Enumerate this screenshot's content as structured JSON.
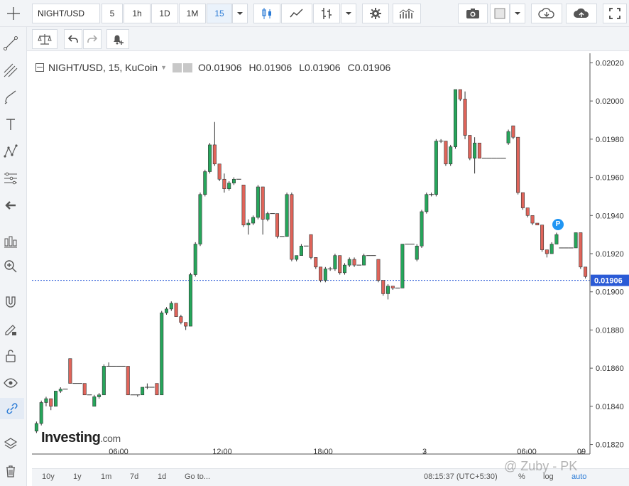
{
  "toolbar": {
    "symbol": "NIGHT/USD",
    "intervals": [
      "5",
      "1h",
      "1D",
      "1M",
      "15"
    ],
    "active_interval": "15"
  },
  "legend": {
    "title": "NIGHT/USD, 15, KuCoin",
    "ohlc": [
      "O0.01906",
      "H0.01906",
      "L0.01906",
      "C0.01906"
    ]
  },
  "price_axis": {
    "ticks": [
      "0.02020",
      "0.02000",
      "0.01980",
      "0.01960",
      "0.01940",
      "0.01920",
      "0.01900",
      "0.01880",
      "0.01860",
      "0.01840",
      "0.01820"
    ],
    "current_price": "0.01906"
  },
  "time_axis": {
    "ticks": [
      "06:00",
      "12:00",
      "18:00",
      "3",
      "06:00",
      "09"
    ]
  },
  "bottom": {
    "ranges": [
      "10y",
      "1y",
      "1m",
      "7d",
      "1d",
      "Go to..."
    ],
    "clock": "08:15:37 (UTC+5:30)",
    "scale_buttons": [
      "%",
      "log",
      "auto"
    ]
  },
  "branding": {
    "logo": "Investing",
    "logo_suffix": ".com",
    "watermark": "@ Zuby - PK",
    "marker": "P"
  },
  "chart_data": {
    "type": "candlestick",
    "up_color": "#26a65b",
    "down_color": "#e0645a",
    "ylim": [
      0.01815,
      0.02025
    ],
    "candles": [
      [
        0.01827,
        0.01832,
        0.01826,
        0.01831
      ],
      [
        0.01831,
        0.01843,
        0.0183,
        0.01842
      ],
      [
        0.01842,
        0.01845,
        0.0184,
        0.01844
      ],
      [
        0.01844,
        0.01844,
        0.01838,
        0.0184
      ],
      [
        0.0184,
        0.01848,
        0.0184,
        0.01848
      ],
      [
        0.01848,
        0.0185,
        0.01847,
        0.01849
      ],
      [
        0.01849,
        0.01849,
        0.01849,
        0.01849
      ],
      [
        0.01865,
        0.01865,
        0.01852,
        0.01852
      ],
      [
        0.01852,
        0.01852,
        0.01852,
        0.01852
      ],
      [
        0.01852,
        0.01852,
        0.01852,
        0.01852
      ],
      [
        0.01852,
        0.01852,
        0.01846,
        0.01846
      ],
      [
        0.01846,
        0.01846,
        0.01846,
        0.01846
      ],
      [
        0.0184,
        0.01846,
        0.0184,
        0.01845
      ],
      [
        0.01845,
        0.01847,
        0.01844,
        0.01846
      ],
      [
        0.01846,
        0.01862,
        0.01846,
        0.01861
      ],
      [
        0.01861,
        0.01863,
        0.01861,
        0.01861
      ],
      [
        0.01861,
        0.01861,
        0.01861,
        0.01861
      ],
      [
        0.01861,
        0.01861,
        0.01861,
        0.01861
      ],
      [
        0.01861,
        0.01861,
        0.01861,
        0.01861
      ],
      [
        0.01861,
        0.01861,
        0.01846,
        0.01846
      ],
      [
        0.01846,
        0.01846,
        0.01846,
        0.01846
      ],
      [
        0.01846,
        0.01846,
        0.01845,
        0.01846
      ],
      [
        0.01846,
        0.0185,
        0.01846,
        0.0185
      ],
      [
        0.0185,
        0.01852,
        0.01849,
        0.0185
      ],
      [
        0.0185,
        0.0185,
        0.0185,
        0.0185
      ],
      [
        0.01852,
        0.01852,
        0.01846,
        0.01846
      ],
      [
        0.01846,
        0.0189,
        0.01846,
        0.01889
      ],
      [
        0.01889,
        0.01892,
        0.01888,
        0.01891
      ],
      [
        0.01891,
        0.01895,
        0.0189,
        0.01894
      ],
      [
        0.01894,
        0.01894,
        0.01887,
        0.01887
      ],
      [
        0.01887,
        0.01888,
        0.01883,
        0.01884
      ],
      [
        0.01884,
        0.01884,
        0.0188,
        0.01882
      ],
      [
        0.01882,
        0.0191,
        0.01882,
        0.01909
      ],
      [
        0.01909,
        0.01926,
        0.01908,
        0.01925
      ],
      [
        0.01925,
        0.01952,
        0.01924,
        0.01951
      ],
      [
        0.01951,
        0.01964,
        0.0195,
        0.01963
      ],
      [
        0.01963,
        0.01978,
        0.01962,
        0.01977
      ],
      [
        0.01977,
        0.01989,
        0.01966,
        0.01967
      ],
      [
        0.01967,
        0.01967,
        0.01958,
        0.01959
      ],
      [
        0.01959,
        0.01962,
        0.01952,
        0.01954
      ],
      [
        0.01954,
        0.01958,
        0.01953,
        0.01957
      ],
      [
        0.01957,
        0.0196,
        0.01956,
        0.01959
      ],
      [
        0.01959,
        0.01959,
        0.01959,
        0.01959
      ],
      [
        0.01956,
        0.01956,
        0.01934,
        0.01935
      ],
      [
        0.01935,
        0.01938,
        0.0193,
        0.01936
      ],
      [
        0.01936,
        0.0194,
        0.01935,
        0.01939
      ],
      [
        0.01939,
        0.01956,
        0.01938,
        0.01955
      ],
      [
        0.01955,
        0.01955,
        0.0193,
        0.01938
      ],
      [
        0.01938,
        0.01942,
        0.01937,
        0.01941
      ],
      [
        0.01941,
        0.01941,
        0.01941,
        0.01941
      ],
      [
        0.01941,
        0.01941,
        0.01928,
        0.01929
      ],
      [
        0.01929,
        0.01929,
        0.01929,
        0.01929
      ],
      [
        0.01929,
        0.01952,
        0.01929,
        0.01951
      ],
      [
        0.01951,
        0.01952,
        0.01916,
        0.01917
      ],
      [
        0.01917,
        0.01919,
        0.01916,
        0.01919
      ],
      [
        0.01919,
        0.01925,
        0.01919,
        0.01924
      ],
      [
        0.01924,
        0.01924,
        0.01924,
        0.01924
      ],
      [
        0.0193,
        0.0193,
        0.01917,
        0.01918
      ],
      [
        0.01918,
        0.01918,
        0.01912,
        0.01913
      ],
      [
        0.01913,
        0.01913,
        0.01905,
        0.01906
      ],
      [
        0.01906,
        0.01913,
        0.01905,
        0.01912
      ],
      [
        0.01912,
        0.01913,
        0.01911,
        0.01912
      ],
      [
        0.01912,
        0.0192,
        0.01911,
        0.01919
      ],
      [
        0.01919,
        0.01919,
        0.01909,
        0.0191
      ],
      [
        0.0191,
        0.01915,
        0.01909,
        0.01914
      ],
      [
        0.01914,
        0.01918,
        0.01913,
        0.01917
      ],
      [
        0.01917,
        0.01918,
        0.01913,
        0.01914
      ],
      [
        0.01914,
        0.01914,
        0.01914,
        0.01914
      ],
      [
        0.01914,
        0.0192,
        0.01914,
        0.01919
      ],
      [
        0.01919,
        0.01919,
        0.01919,
        0.01919
      ],
      [
        0.01919,
        0.01919,
        0.01919,
        0.01919
      ],
      [
        0.01917,
        0.01917,
        0.01905,
        0.01906
      ],
      [
        0.01906,
        0.01906,
        0.01898,
        0.01899
      ],
      [
        0.01899,
        0.01904,
        0.01896,
        0.01903
      ],
      [
        0.01903,
        0.01903,
        0.01901,
        0.01902
      ],
      [
        0.01902,
        0.01902,
        0.01902,
        0.01902
      ],
      [
        0.01902,
        0.01925,
        0.01902,
        0.01925
      ],
      [
        0.01925,
        0.01925,
        0.01925,
        0.01925
      ],
      [
        0.01925,
        0.01925,
        0.01925,
        0.01925
      ],
      [
        0.01917,
        0.01925,
        0.01916,
        0.01924
      ],
      [
        0.01924,
        0.01943,
        0.01923,
        0.01942
      ],
      [
        0.01942,
        0.01952,
        0.01941,
        0.01951
      ],
      [
        0.01951,
        0.01952,
        0.0195,
        0.01951
      ],
      [
        0.01951,
        0.0198,
        0.0195,
        0.01979
      ],
      [
        0.01979,
        0.0198,
        0.01978,
        0.01979
      ],
      [
        0.01979,
        0.01979,
        0.01966,
        0.01967
      ],
      [
        0.01967,
        0.01977,
        0.01966,
        0.01976
      ],
      [
        0.01976,
        0.02006,
        0.01975,
        0.02006
      ],
      [
        0.02006,
        0.02006,
        0.02,
        0.02001
      ],
      [
        0.02001,
        0.02005,
        0.0198,
        0.01982
      ],
      [
        0.01982,
        0.01982,
        0.01969,
        0.0197
      ],
      [
        0.0197,
        0.01981,
        0.01962,
        0.01978
      ],
      [
        0.01978,
        0.01978,
        0.0197,
        0.0197
      ],
      [
        0.0197,
        0.0197,
        0.0197,
        0.0197
      ],
      [
        0.0197,
        0.0197,
        0.0197,
        0.0197
      ],
      [
        0.0197,
        0.0197,
        0.0197,
        0.0197
      ],
      [
        0.0197,
        0.0197,
        0.0197,
        0.0197
      ],
      [
        0.0197,
        0.0197,
        0.0197,
        0.0197
      ],
      [
        0.01978,
        0.01985,
        0.01977,
        0.01984
      ],
      [
        0.01987,
        0.01987,
        0.0198,
        0.01981
      ],
      [
        0.01981,
        0.01981,
        0.01951,
        0.01952
      ],
      [
        0.01952,
        0.01952,
        0.01943,
        0.01944
      ],
      [
        0.01944,
        0.01944,
        0.01939,
        0.0194
      ],
      [
        0.0194,
        0.0194,
        0.01935,
        0.01936
      ],
      [
        0.01936,
        0.01936,
        0.01935,
        0.01935
      ],
      [
        0.01935,
        0.01935,
        0.01921,
        0.01922
      ],
      [
        0.01922,
        0.01922,
        0.01918,
        0.0192
      ],
      [
        0.0192,
        0.01926,
        0.0192,
        0.01925
      ],
      [
        0.01925,
        0.01931,
        0.01925,
        0.0193
      ],
      [
        0.01923,
        0.01923,
        0.01923,
        0.01923
      ],
      [
        0.01923,
        0.01923,
        0.01923,
        0.01923
      ],
      [
        0.01923,
        0.01923,
        0.01923,
        0.01923
      ],
      [
        0.01923,
        0.01931,
        0.01923,
        0.01931
      ],
      [
        0.01931,
        0.01931,
        0.01912,
        0.01913
      ],
      [
        0.01913,
        0.01913,
        0.01907,
        0.01908
      ]
    ]
  }
}
